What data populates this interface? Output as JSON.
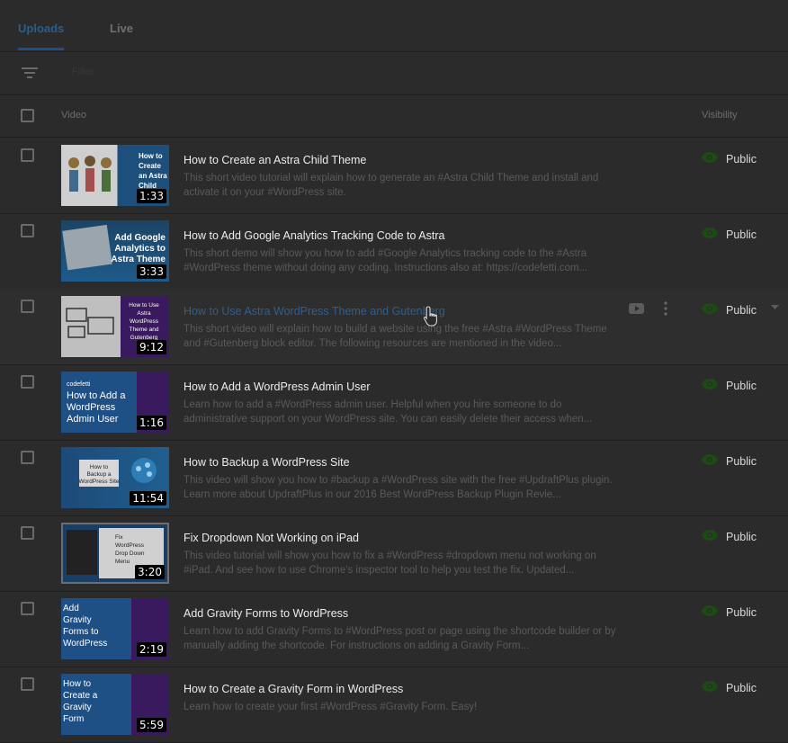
{
  "tabs": [
    {
      "label": "Uploads",
      "active": true
    },
    {
      "label": "Live",
      "active": false
    }
  ],
  "filter": {
    "placeholder": "Filter"
  },
  "table": {
    "headers": {
      "video": "Video",
      "visibility": "Visibility"
    }
  },
  "videos": [
    {
      "title": "How to Create an Astra Child Theme",
      "description": "This short video tutorial will explain how to generate an #Astra Child Theme and install and activate it on your #WordPress site.",
      "duration": "1:33",
      "visibility": "Public",
      "thumb_text": "How to Create an Astra Child"
    },
    {
      "title": "How to Add Google Analytics Tracking Code to Astra",
      "description": "This short demo will show you how to add #Google Analytics tracking code to the #Astra #WordPress theme without doing any coding. Instructions also at: https://codefetti.com...",
      "duration": "3:33",
      "visibility": "Public",
      "thumb_text": "Add Google Analytics to Astra Theme"
    },
    {
      "title": "How to Use Astra WordPress Theme and Gutenberg",
      "description": "This short video will explain how to build a website using the free #Astra #WordPress Theme and #Gutenberg block editor. The following resources are mentioned in the video...",
      "duration": "9:12",
      "visibility": "Public",
      "thumb_text": "How to Use Astra WordPress Theme and Gutenberg",
      "hovered": true
    },
    {
      "title": "How to Add a WordPress Admin User",
      "description": "Learn how to add a #WordPress admin user. Helpful when you hire someone to do administrative support on your WordPress site. You can easily delete their access when...",
      "duration": "1:16",
      "visibility": "Public",
      "thumb_text": "How to Add a WordPress Admin User"
    },
    {
      "title": "How to Backup a WordPress Site",
      "description": "This video will show you how to #backup a #WordPress site with the free #UpdraftPlus plugin. Learn more about UpdraftPlus in our 2016 Best WordPress Backup Plugin Revie...",
      "duration": "11:54",
      "visibility": "Public",
      "thumb_text": "How to Backup a WordPress Site"
    },
    {
      "title": "Fix Dropdown Not Working on iPad",
      "description": "This video tutorial will show you how to fix a #WordPress #dropdown menu not working on #iPad. And see how to use Chrome's inspector tool to help you test the fix. Updated...",
      "duration": "3:20",
      "visibility": "Public",
      "thumb_text": "Fix WordPress Drop Down Menu"
    },
    {
      "title": "Add Gravity Forms to WordPress",
      "description": "Learn how to add Gravity Forms to #WordPress post or page using the shortcode builder or by manually adding the shortcode. For instructions on adding a Gravity Form...",
      "duration": "2:19",
      "visibility": "Public",
      "thumb_text": "Add Gravity Forms to WordPress"
    },
    {
      "title": "How to Create a Gravity Form in WordPress",
      "description": "Learn how to create your first #WordPress #Gravity Form. Easy!",
      "duration": "5:59",
      "visibility": "Public",
      "thumb_text": "How to Create a Gravity Form"
    }
  ],
  "colors": {
    "visibility_eye": "#1b4d12",
    "accent": "#1f4f85"
  }
}
